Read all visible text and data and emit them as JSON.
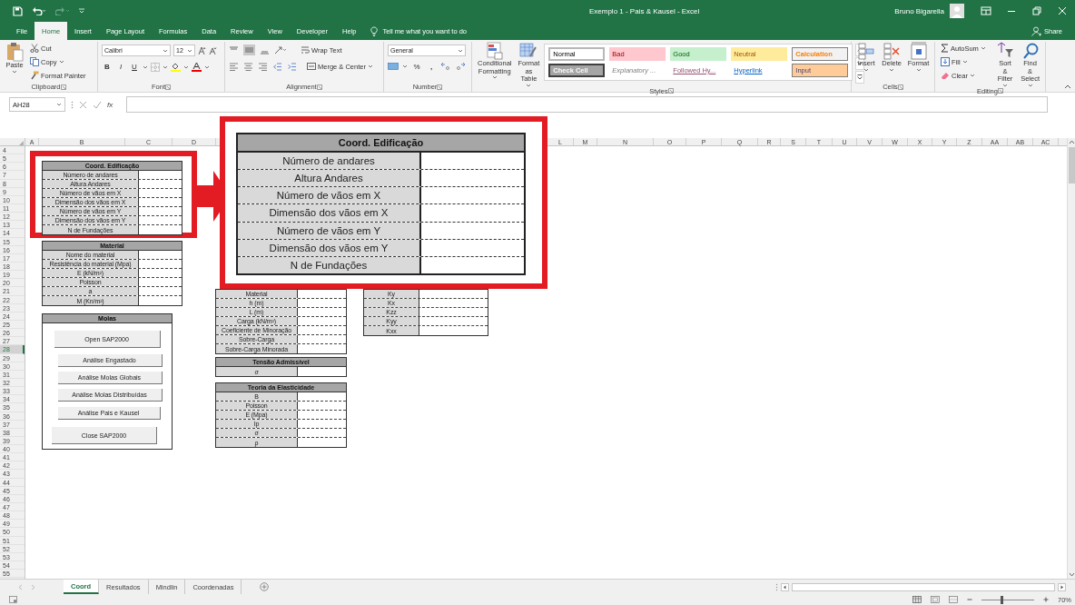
{
  "window": {
    "title": "Exemplo 1 - Pais & Kausel  -  Excel",
    "user": "Bruno Bigarella"
  },
  "tabs": [
    {
      "label": "File",
      "selected": false
    },
    {
      "label": "Home",
      "selected": true
    },
    {
      "label": "Insert",
      "selected": false
    },
    {
      "label": "Page Layout",
      "selected": false
    },
    {
      "label": "Formulas",
      "selected": false
    },
    {
      "label": "Data",
      "selected": false
    },
    {
      "label": "Review",
      "selected": false
    },
    {
      "label": "View",
      "selected": false
    },
    {
      "label": "Developer",
      "selected": false
    },
    {
      "label": "Help",
      "selected": false
    }
  ],
  "tell_me": "Tell me what you want to do",
  "share": "Share",
  "ribbon": {
    "clipboard": {
      "label": "Clipboard",
      "paste": "Paste",
      "cut": "Cut",
      "copy": "Copy",
      "format_painter": "Format Painter"
    },
    "font": {
      "label": "Font",
      "name": "Calibri",
      "size": "12",
      "styles": [
        "B",
        "I",
        "U"
      ]
    },
    "alignment": {
      "label": "Alignment",
      "wrap": "Wrap Text",
      "merge": "Merge & Center"
    },
    "number": {
      "label": "Number",
      "format": "General",
      "percent": "%",
      "comma": ","
    },
    "styles": {
      "label": "Styles",
      "conditional": "Conditional Formatting",
      "table": "Format as Table",
      "cells": [
        {
          "label": "Normal",
          "kind": "normal"
        },
        {
          "label": "Bad",
          "kind": "bad"
        },
        {
          "label": "Good",
          "kind": "good"
        },
        {
          "label": "Neutral",
          "kind": "neutral"
        },
        {
          "label": "Calculation",
          "kind": "calculation"
        },
        {
          "label": "Check Cell",
          "kind": "check"
        },
        {
          "label": "Explanatory ...",
          "kind": "explanatory"
        },
        {
          "label": "Followed Hy...",
          "kind": "followed"
        },
        {
          "label": "Hyperlink",
          "kind": "hyperlink"
        },
        {
          "label": "Input",
          "kind": "input"
        }
      ]
    },
    "cells": {
      "label": "Cells",
      "buttons": [
        "Insert",
        "Delete",
        "Format"
      ]
    },
    "editing": {
      "label": "Editing",
      "autosum": "AutoSum",
      "fill": "Fill",
      "clear": "Clear",
      "sort": "Sort & Filter",
      "find": "Find & Select"
    }
  },
  "formula_bar": {
    "name_box": "AH28",
    "fx": "fx"
  },
  "columns": [
    "A",
    "B",
    "C",
    "D",
    "L",
    "M",
    "N",
    "O",
    "P",
    "Q",
    "R",
    "S",
    "T",
    "U",
    "V",
    "W",
    "X",
    "Y",
    "Z",
    "AA",
    "AB",
    "AC"
  ],
  "rows": [
    {
      "label": "4",
      "selected": false
    },
    {
      "label": "5",
      "selected": false
    },
    {
      "label": "6",
      "selected": false
    },
    {
      "label": "7",
      "selected": false
    },
    {
      "label": "8",
      "selected": false
    },
    {
      "label": "9",
      "selected": false
    },
    {
      "label": "10",
      "selected": false
    },
    {
      "label": "11",
      "selected": false
    },
    {
      "label": "12",
      "selected": false
    },
    {
      "label": "13",
      "selected": false
    },
    {
      "label": "14",
      "selected": false
    },
    {
      "label": "15",
      "selected": false
    },
    {
      "label": "16",
      "selected": false
    },
    {
      "label": "17",
      "selected": false
    },
    {
      "label": "18",
      "selected": false
    },
    {
      "label": "19",
      "selected": false
    },
    {
      "label": "20",
      "selected": false
    },
    {
      "label": "21",
      "selected": false
    },
    {
      "label": "22",
      "selected": false
    },
    {
      "label": "23",
      "selected": false
    },
    {
      "label": "24",
      "selected": false
    },
    {
      "label": "25",
      "selected": false
    },
    {
      "label": "26",
      "selected": false
    },
    {
      "label": "27",
      "selected": false
    },
    {
      "label": "28",
      "selected": true
    },
    {
      "label": "29",
      "selected": false
    },
    {
      "label": "30",
      "selected": false
    },
    {
      "label": "31",
      "selected": false
    },
    {
      "label": "32",
      "selected": false
    },
    {
      "label": "33",
      "selected": false
    },
    {
      "label": "34",
      "selected": false
    },
    {
      "label": "35",
      "selected": false
    },
    {
      "label": "36",
      "selected": false
    },
    {
      "label": "37",
      "selected": false
    },
    {
      "label": "38",
      "selected": false
    },
    {
      "label": "39",
      "selected": false
    },
    {
      "label": "40",
      "selected": false
    },
    {
      "label": "41",
      "selected": false
    },
    {
      "label": "42",
      "selected": false
    },
    {
      "label": "43",
      "selected": false
    },
    {
      "label": "44",
      "selected": false
    },
    {
      "label": "45",
      "selected": false
    },
    {
      "label": "46",
      "selected": false
    },
    {
      "label": "47",
      "selected": false
    },
    {
      "label": "48",
      "selected": false
    },
    {
      "label": "49",
      "selected": false
    },
    {
      "label": "50",
      "selected": false
    },
    {
      "label": "51",
      "selected": false
    },
    {
      "label": "52",
      "selected": false
    },
    {
      "label": "53",
      "selected": false
    },
    {
      "label": "54",
      "selected": false
    },
    {
      "label": "55",
      "selected": false
    }
  ],
  "sheet": {
    "tables": [
      {
        "title": "Coord. Edificação",
        "rows": [
          "Número de andares",
          "Altura Andares",
          "Número de vãos em X",
          "Dimensão dos vãos em X",
          "Número de vãos em Y",
          "Dimensão dos vãos em Y",
          "N de Fundações"
        ]
      },
      {
        "title": "Material",
        "rows": [
          "Nome do material",
          "Resistência do material (Mpa)",
          "E (kN/m²)",
          "Poisson",
          "a",
          "M (Kn/m²)"
        ]
      },
      {
        "rows": [
          "Material",
          "h (m)",
          "L (m)",
          "Carga (kN/m²)",
          "Coeficiente de Minoração",
          "Sobre-Carga",
          "Sobre-Carga Minorada"
        ]
      },
      {
        "title": "Tensão Admissível",
        "rows": [
          "σ"
        ]
      },
      {
        "title": "Teoria da Elasticidade",
        "rows": [
          "B",
          "Poisson",
          "E (Mpa)",
          "Ip",
          "σ",
          "ρ"
        ]
      },
      {
        "rows": [
          "Ky",
          "Kx",
          "Kzz",
          "Kyy",
          "Kxx"
        ]
      }
    ],
    "panel": {
      "title": "Molas",
      "buttons": [
        "Open SAP2000",
        "Análise Engastado",
        "Análise Molas Globais",
        "Análise Molas Distribuídas",
        "Análise Pais e Kausel",
        "Close SAP2000"
      ]
    }
  },
  "callout": {
    "title": "Coord. Edificação",
    "rows": [
      "Número de andares",
      "Altura Andares",
      "Número de vãos em X",
      "Dimensão dos vãos em X",
      "Número de vãos em Y",
      "Dimensão dos vãos em Y",
      "N de Fundações"
    ]
  },
  "sheet_tabs": [
    {
      "label": "Coord",
      "selected": true
    },
    {
      "label": "Resultados",
      "selected": false
    },
    {
      "label": "Mindlin",
      "selected": false
    },
    {
      "label": "Coordenadas",
      "selected": false
    }
  ],
  "status_bar": {
    "zoom": {
      "level": 0.36,
      "reading": "70%"
    }
  }
}
